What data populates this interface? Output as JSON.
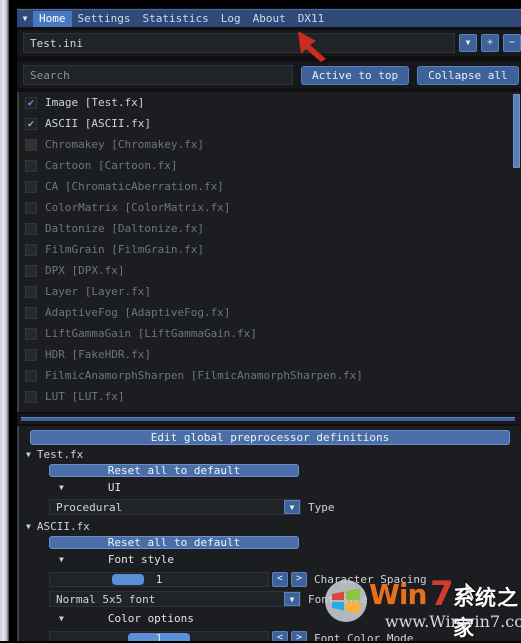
{
  "window": {
    "title_tabs": [
      "Home",
      "Settings",
      "Statistics",
      "Log",
      "About",
      "DX11"
    ],
    "caret_icon": "▼"
  },
  "tabs": {
    "active": "Home",
    "items": [
      {
        "label": "Home",
        "active": true
      },
      {
        "label": "Settings",
        "active": false
      },
      {
        "label": "Statistics",
        "active": false
      },
      {
        "label": "Log",
        "active": false
      },
      {
        "label": "About",
        "active": false
      },
      {
        "label": "DX11",
        "active": false
      }
    ]
  },
  "preset_row": {
    "value": "Test.ini",
    "dropdown_label": "▼",
    "add_label": "+",
    "remove_label": "−"
  },
  "search_row": {
    "placeholder": "Search",
    "value": "Search",
    "active_to_top_label": "Active to top",
    "collapse_all_label": "Collapse all"
  },
  "effect_list": {
    "items": [
      {
        "label": "Image [Test.fx]",
        "checked": true,
        "check_glyph": "✔",
        "state": "blue"
      },
      {
        "label": "ASCII [ASCII.fx]",
        "checked": true,
        "check_glyph": "✔",
        "state": "gray"
      },
      {
        "label": "Chromakey [Chromakey.fx]",
        "checked": false,
        "check_glyph": "",
        "state": "olive"
      },
      {
        "label": "Cartoon [Cartoon.fx]",
        "checked": false,
        "check_glyph": "",
        "state": "off"
      },
      {
        "label": "CA [ChromaticAberration.fx]",
        "checked": false,
        "check_glyph": "",
        "state": "off"
      },
      {
        "label": "ColorMatrix [ColorMatrix.fx]",
        "checked": false,
        "check_glyph": "",
        "state": "off"
      },
      {
        "label": "Daltonize [Daltonize.fx]",
        "checked": false,
        "check_glyph": "",
        "state": "off"
      },
      {
        "label": "FilmGrain [FilmGrain.fx]",
        "checked": false,
        "check_glyph": "",
        "state": "off"
      },
      {
        "label": "DPX [DPX.fx]",
        "checked": false,
        "check_glyph": "",
        "state": "off"
      },
      {
        "label": "Layer [Layer.fx]",
        "checked": false,
        "check_glyph": "",
        "state": "off"
      },
      {
        "label": "AdaptiveFog [AdaptiveFog.fx]",
        "checked": false,
        "check_glyph": "",
        "state": "off"
      },
      {
        "label": "LiftGammaGain [LiftGammaGain.fx]",
        "checked": false,
        "check_glyph": "",
        "state": "off"
      },
      {
        "label": "HDR [FakeHDR.fx]",
        "checked": false,
        "check_glyph": "",
        "state": "off"
      },
      {
        "label": "FilmicAnamorphSharpen [FilmicAnamorphSharpen.fx]",
        "checked": false,
        "check_glyph": "",
        "state": "off"
      },
      {
        "label": "LUT [LUT.fx]",
        "checked": false,
        "check_glyph": "",
        "state": "off"
      }
    ]
  },
  "settings_panel": {
    "edit_global_label": "Edit global preprocessor definitions",
    "groups": [
      {
        "name": "Test.fx",
        "tri": "▼",
        "reset_label": "Reset all to default",
        "sub": {
          "tri": "▼",
          "label": "UI"
        },
        "combo": {
          "value": "Procedural",
          "arrow": "▼",
          "label": "Type"
        }
      },
      {
        "name": "ASCII.fx",
        "tri": "▼",
        "reset_label": "Reset all to default",
        "sub": {
          "tri": "▼",
          "label": "Font style"
        },
        "slider1": {
          "value": "1",
          "dec": "<",
          "inc": ">",
          "label": "Character Spacing",
          "fill_pct": 36,
          "thumb_w": 32
        },
        "combo": {
          "value": "Normal 5x5 font",
          "arrow": "▼",
          "label": "Font Size"
        },
        "sub2": {
          "tri": "▼",
          "label": "Color options"
        },
        "slider2": {
          "value": "1",
          "dec": "<",
          "inc": ">",
          "label": "Font Color Mode",
          "fill_pct": 50,
          "thumb_w": 62
        }
      }
    ]
  },
  "overlays": {
    "red_arrow_name": "annotation-arrow",
    "cursor_name": "mouse-cursor",
    "watermark": {
      "brand": "Win",
      "number": "7",
      "suffix": "系统之家",
      "url": "www.Winwin7.com"
    }
  },
  "colors": {
    "accent_blue": "#3d6199",
    "button_blue": "#4a6fa8",
    "tab_active": "#4878c0",
    "panel_bg": "#1b1d20",
    "chrome_bg": "#16181b",
    "slider_thumb": "#5b8fd8",
    "arrow_red": "#cc2b20"
  }
}
